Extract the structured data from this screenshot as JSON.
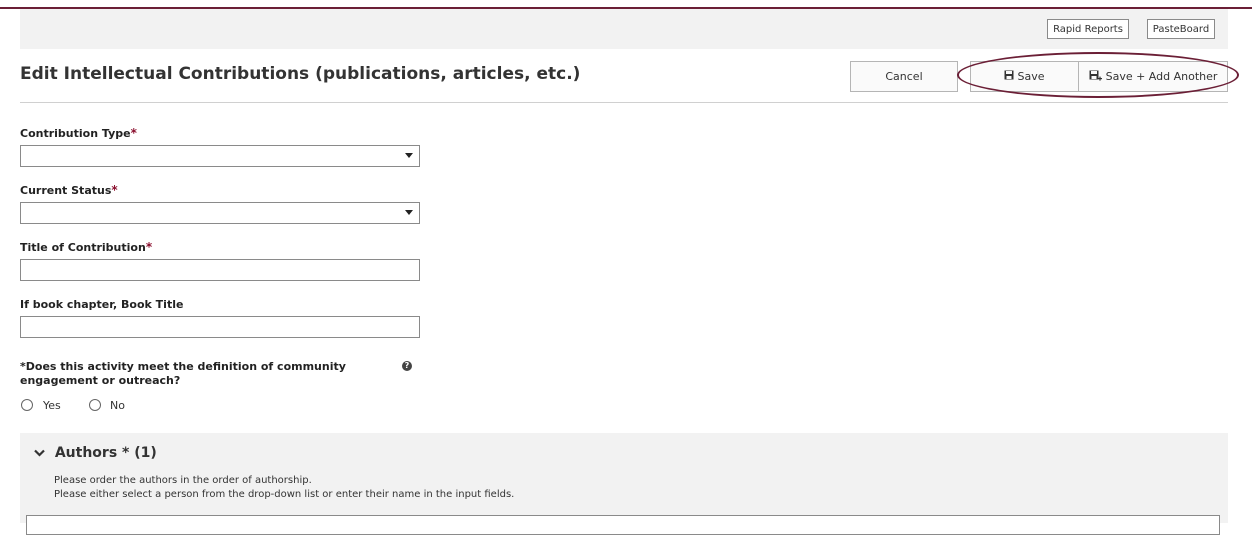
{
  "topbar": {
    "rapid_reports": "Rapid Reports",
    "pasteboard": "PasteBoard"
  },
  "header": {
    "title": "Edit Intellectual Contributions (publications, articles, etc.)",
    "cancel": "Cancel",
    "save": "Save",
    "save_add": "Save + Add Another"
  },
  "form": {
    "contribution_type": {
      "label": "Contribution Type",
      "value": ""
    },
    "current_status": {
      "label": "Current Status",
      "value": ""
    },
    "title": {
      "label": "Title of Contribution",
      "value": ""
    },
    "book_title": {
      "label": "If book chapter, Book Title",
      "value": ""
    },
    "required_mark": "*",
    "community": {
      "question": "*Does this activity meet the definition of community engagement or outreach?",
      "yes": "Yes",
      "no": "No",
      "help_icon": "?"
    }
  },
  "authors": {
    "heading": "Authors * (1)",
    "note1": "Please order the authors in the order of authorship.",
    "note2": "Please either select a person from the drop-down list or enter their name in the input fields."
  },
  "colors": {
    "accent": "#6b1f36",
    "required": "#8b0f2e"
  },
  "icons": {
    "save": "floppy-disk-icon",
    "save_add": "floppy-plus-icon",
    "dropdown": "caret-down-icon",
    "collapse": "chevron-down-icon",
    "help": "question-circle-icon"
  }
}
